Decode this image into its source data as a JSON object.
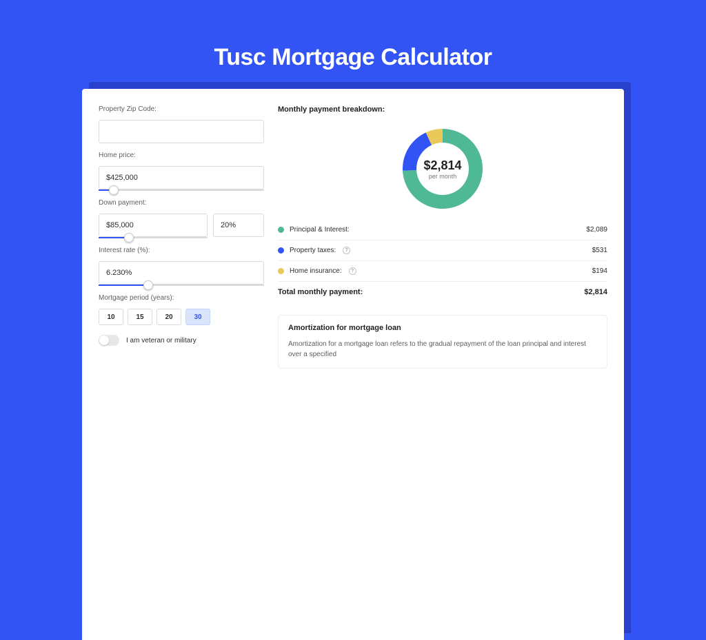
{
  "page": {
    "title": "Tusc Mortgage Calculator"
  },
  "form": {
    "zip_label": "Property Zip Code:",
    "zip_value": "",
    "price_label": "Home price:",
    "price_value": "$425,000",
    "down_label": "Down payment:",
    "down_value": "$85,000",
    "down_pct": "20%",
    "rate_label": "Interest rate (%):",
    "rate_value": "6.230%",
    "period_label": "Mortgage period (years):",
    "periods": [
      "10",
      "15",
      "20",
      "30"
    ],
    "period_active": "30",
    "veteran_label": "I am veteran or military"
  },
  "breakdown": {
    "title": "Monthly payment breakdown:",
    "total_amount": "$2,814",
    "total_sub": "per month",
    "rows": [
      {
        "label": "Principal & Interest:",
        "value": "$2,089",
        "color": "#4fb894",
        "has_hint": false
      },
      {
        "label": "Property taxes:",
        "value": "$531",
        "color": "#3254f4",
        "has_hint": true
      },
      {
        "label": "Home insurance:",
        "value": "$194",
        "color": "#e8c95a",
        "has_hint": true
      }
    ],
    "total_row": {
      "label": "Total monthly payment:",
      "value": "$2,814"
    }
  },
  "chart_data": {
    "type": "pie",
    "title": "Monthly payment breakdown",
    "series": [
      {
        "name": "Principal & Interest",
        "value": 2089,
        "color": "#4fb894"
      },
      {
        "name": "Property taxes",
        "value": 531,
        "color": "#3254f4"
      },
      {
        "name": "Home insurance",
        "value": 194,
        "color": "#e8c95a"
      }
    ],
    "total": 2814,
    "center_label": "$2,814",
    "center_sub": "per month"
  },
  "amortization": {
    "title": "Amortization for mortgage loan",
    "text": "Amortization for a mortgage loan refers to the gradual repayment of the loan principal and interest over a specified"
  }
}
